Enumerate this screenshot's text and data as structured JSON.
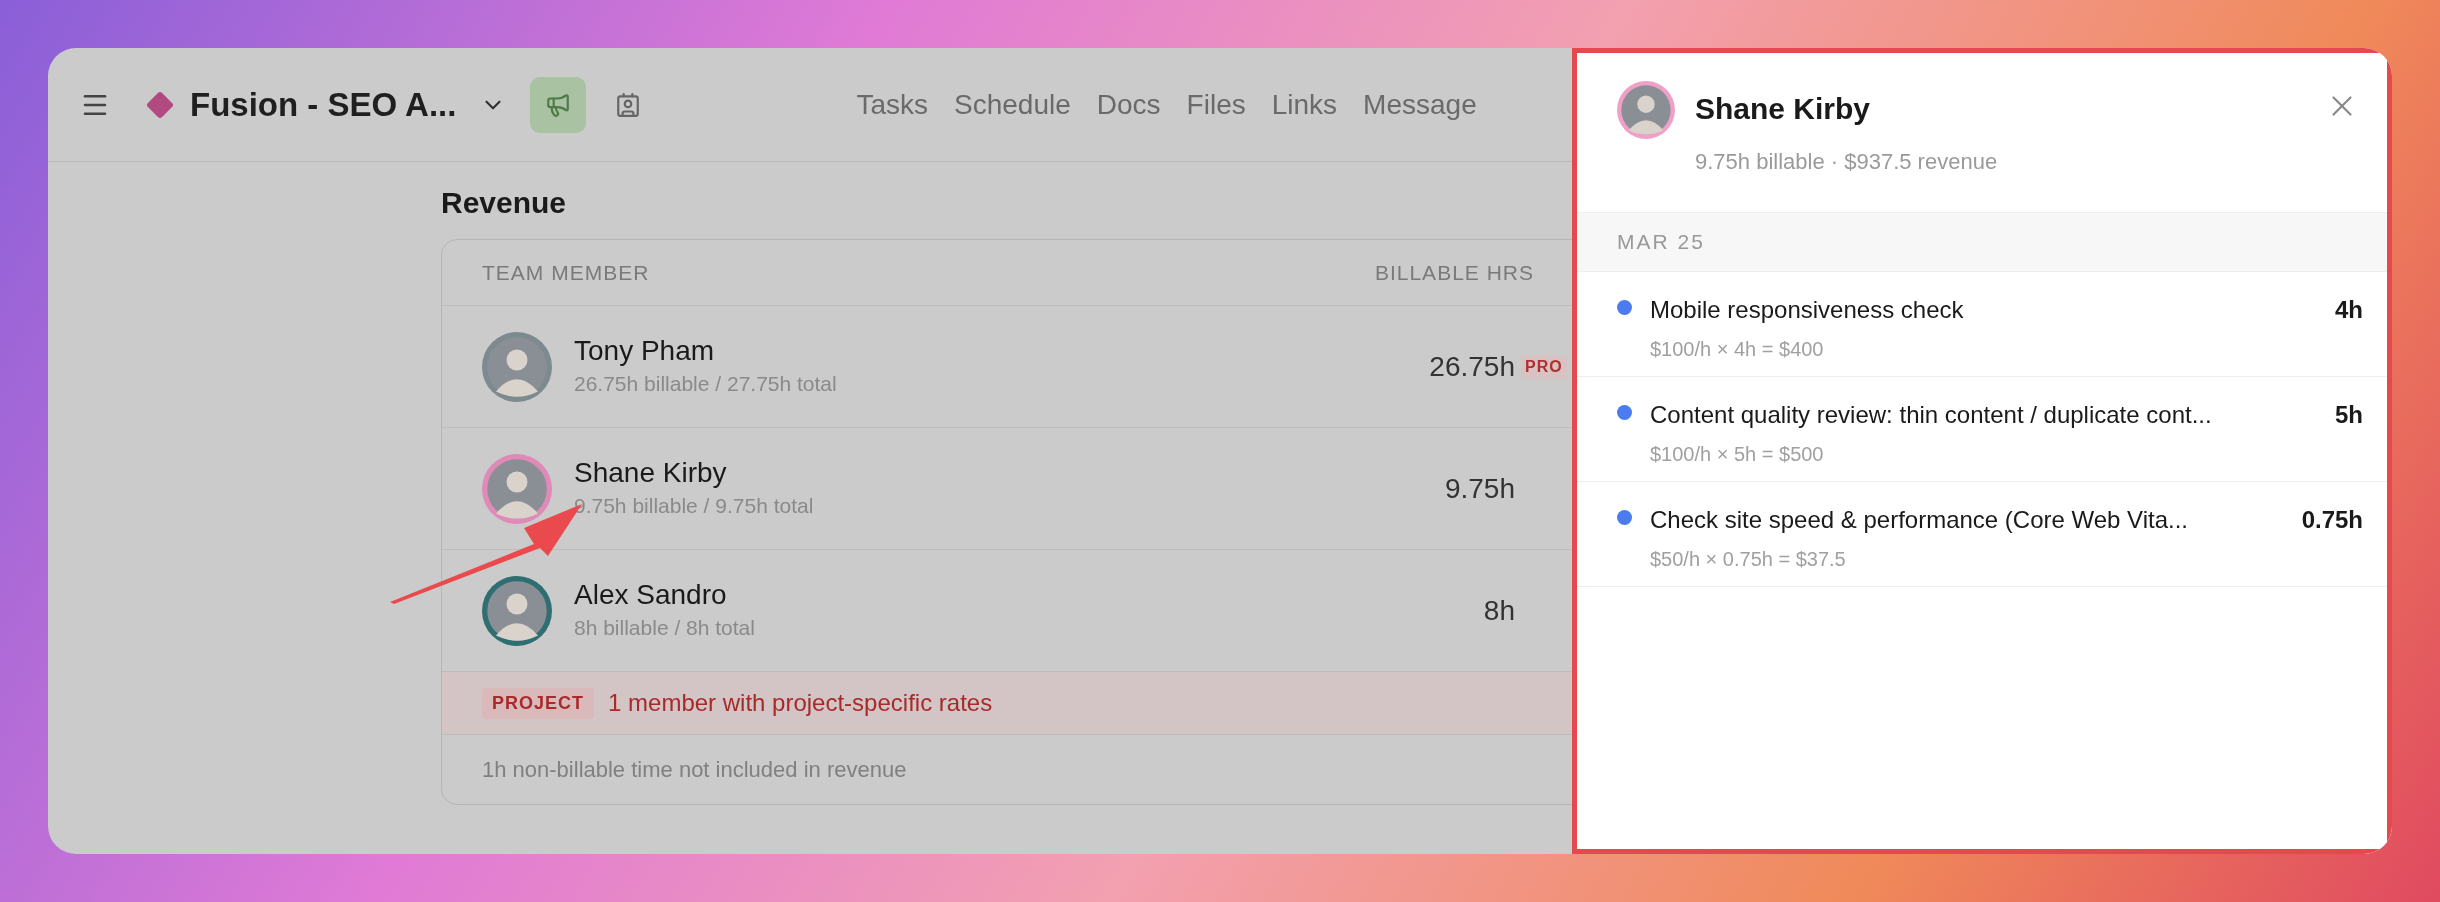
{
  "header": {
    "title": "Fusion - SEO A...",
    "tools": [
      {
        "kind": "megaphone",
        "selected": true
      },
      {
        "kind": "contacts",
        "selected": false
      }
    ],
    "nav": [
      {
        "label": "Tasks"
      },
      {
        "label": "Schedule"
      },
      {
        "label": "Docs"
      },
      {
        "label": "Files"
      },
      {
        "label": "Links"
      },
      {
        "label": "Message"
      }
    ]
  },
  "revenue": {
    "title": "Revenue",
    "columns": [
      "TEAM MEMBER",
      "BILLABLE HRS"
    ],
    "rows": [
      {
        "name": "Tony Pham",
        "detail": "26.75h billable / 27.75h total",
        "hours": "26.75h",
        "badge": "PRO"
      },
      {
        "name": "Shane Kirby",
        "detail": "9.75h billable / 9.75h total",
        "hours": "9.75h"
      },
      {
        "name": "Alex Sandro",
        "detail": "8h billable / 8h total",
        "hours": "8h"
      }
    ],
    "notice": {
      "badge": "PROJECT",
      "text": "1 member with project-specific rates"
    },
    "footer": "1h non-billable time not included in revenue"
  },
  "panel": {
    "name": "Shane Kirby",
    "summary": "9.75h billable · $937.5 revenue",
    "groups": [
      {
        "date": "MAR 25",
        "entries": [
          {
            "title": "Mobile responsiveness check",
            "calc": "$100/h × 4h = $400",
            "hours": "4h"
          },
          {
            "title": "Content quality review: thin content / duplicate cont...",
            "calc": "$100/h × 5h = $500",
            "hours": "5h"
          },
          {
            "title": "Check site speed & performance (Core Web Vita...",
            "calc": "$50/h × 0.75h = $37.5",
            "hours": "0.75h"
          }
        ]
      }
    ]
  }
}
